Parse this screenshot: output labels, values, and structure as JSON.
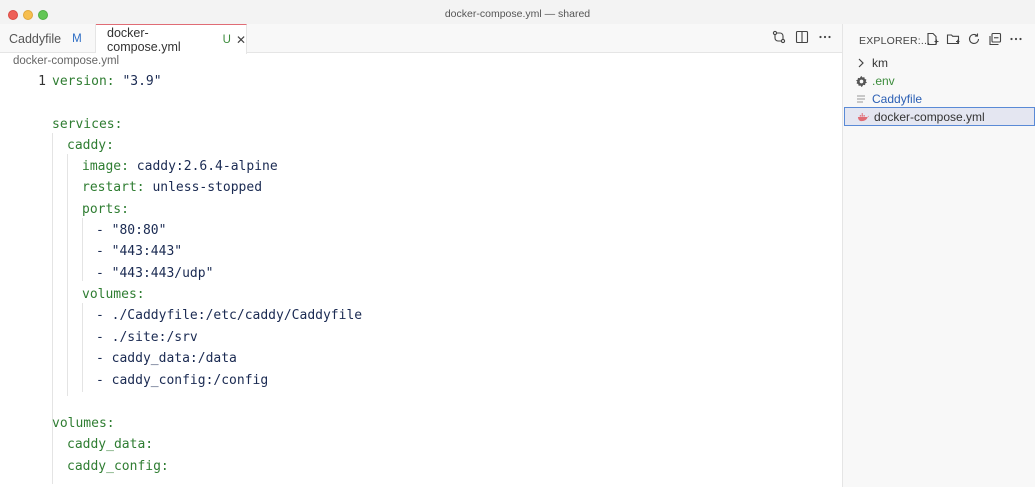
{
  "window": {
    "title": "docker-compose.yml — shared"
  },
  "tabs": [
    {
      "label": "Caddyfile",
      "status": "M"
    },
    {
      "label": "docker-compose.yml",
      "status": "U",
      "close": "✕"
    }
  ],
  "breadcrumb": "docker-compose.yml",
  "editor": {
    "line_number": "1",
    "lines": [
      {
        "key": "version:",
        "value": " \"3.9\""
      },
      {
        "key": "services:",
        "value": ""
      },
      {
        "key": "caddy:",
        "value": ""
      },
      {
        "key": "image:",
        "value": " caddy:2.6.4-alpine"
      },
      {
        "key": "restart:",
        "value": " unless-stopped"
      },
      {
        "key": "ports:",
        "value": ""
      },
      {
        "key": "",
        "value": "- \"80:80\""
      },
      {
        "key": "",
        "value": "- \"443:443\""
      },
      {
        "key": "",
        "value": "- \"443:443/udp\""
      },
      {
        "key": "volumes:",
        "value": ""
      },
      {
        "key": "",
        "value": "- ./Caddyfile:/etc/caddy/Caddyfile"
      },
      {
        "key": "",
        "value": "- ./site:/srv"
      },
      {
        "key": "",
        "value": "- caddy_data:/data"
      },
      {
        "key": "",
        "value": "- caddy_config:/config"
      },
      {
        "key": "volumes:",
        "value": ""
      },
      {
        "key": "caddy_data:",
        "value": ""
      },
      {
        "key": "caddy_config:",
        "value": ""
      }
    ]
  },
  "sidebar": {
    "header": "EXPLORER:...",
    "items": [
      {
        "label": "km",
        "icon": "chevron-right-icon"
      },
      {
        "label": ".env",
        "icon": "gear-icon"
      },
      {
        "label": "Caddyfile",
        "icon": "text-file-icon"
      },
      {
        "label": "docker-compose.yml",
        "icon": "docker-icon"
      }
    ]
  }
}
